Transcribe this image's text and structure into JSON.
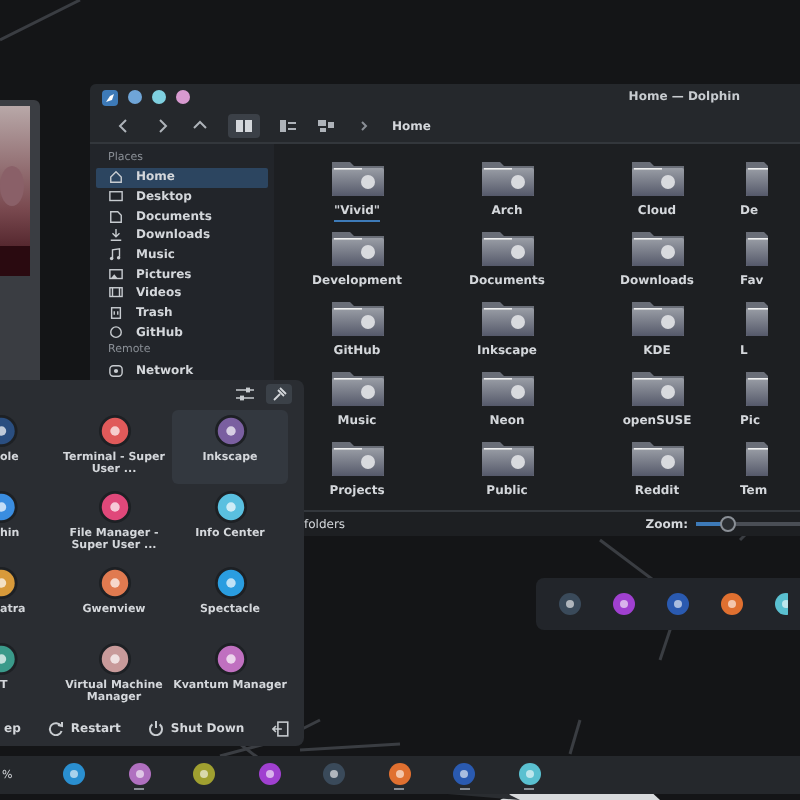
{
  "dolphin": {
    "title": "Home — Dolphin",
    "breadcrumb": "Home",
    "places_header": "Places",
    "places": [
      {
        "label": "Home",
        "selected": true
      },
      {
        "label": "Desktop",
        "selected": false
      },
      {
        "label": "Documents",
        "selected": false
      },
      {
        "label": "Downloads",
        "selected": false
      },
      {
        "label": "Music",
        "selected": false
      },
      {
        "label": "Pictures",
        "selected": false
      },
      {
        "label": "Videos",
        "selected": false
      },
      {
        "label": "Trash",
        "selected": false
      },
      {
        "label": "GitHub",
        "selected": false
      }
    ],
    "remote_header": "Remote",
    "remote": [
      {
        "label": "Network",
        "selected": false
      }
    ],
    "folders": [
      {
        "label": "\"Vivid\"",
        "selected": true
      },
      {
        "label": "Arch",
        "selected": false
      },
      {
        "label": "Cloud",
        "selected": false
      },
      {
        "label": "De",
        "selected": false
      },
      {
        "label": "Development",
        "selected": false
      },
      {
        "label": "Documents",
        "selected": false
      },
      {
        "label": "Downloads",
        "selected": false
      },
      {
        "label": "Fav",
        "selected": false
      },
      {
        "label": "GitHub",
        "selected": false
      },
      {
        "label": "Inkscape",
        "selected": false
      },
      {
        "label": "KDE",
        "selected": false
      },
      {
        "label": "L",
        "selected": false
      },
      {
        "label": "Music",
        "selected": false
      },
      {
        "label": "Neon",
        "selected": false
      },
      {
        "label": "openSUSE",
        "selected": false
      },
      {
        "label": "Pic",
        "selected": false
      },
      {
        "label": "Projects",
        "selected": false
      },
      {
        "label": "Public",
        "selected": false
      },
      {
        "label": "Reddit",
        "selected": false
      },
      {
        "label": "Tem",
        "selected": false
      }
    ],
    "status": "folders",
    "zoom_label": "Zoom:",
    "zoom": {
      "level": 0.3
    }
  },
  "launcher": {
    "apps": [
      {
        "label": "ole",
        "color": "#2a4e80",
        "selected": false
      },
      {
        "label": "Terminal - Super User ...",
        "color": "#e05a5a",
        "selected": false
      },
      {
        "label": "Inkscape",
        "color": "#7a5fa0",
        "selected": true
      },
      {
        "label": "hin",
        "color": "#3a8de0",
        "selected": false
      },
      {
        "label": "File Manager - Super User ...",
        "color": "#e0487a",
        "selected": false
      },
      {
        "label": "Info Center",
        "color": "#5ac0e0",
        "selected": false
      },
      {
        "label": "atra",
        "color": "#d89a3a",
        "selected": false
      },
      {
        "label": "Gwenview",
        "color": "#e07a50",
        "selected": false
      },
      {
        "label": "Spectacle",
        "color": "#2a9de0",
        "selected": false
      },
      {
        "label": "T",
        "color": "#3a9a8a",
        "selected": false
      },
      {
        "label": "Virtual Machine Manager",
        "color": "#c89a9a",
        "selected": false
      },
      {
        "label": "Kvantum Manager",
        "color": "#c070c0",
        "selected": false
      }
    ],
    "power": [
      {
        "label": "ep"
      },
      {
        "label": "Restart"
      },
      {
        "label": "Shut Down"
      }
    ]
  },
  "dock": {
    "apps": [
      {
        "color": "#3a4a5a"
      },
      {
        "color": "#a040d0"
      },
      {
        "color": "#2a5ab0"
      },
      {
        "color": "#e07030"
      },
      {
        "color": "#5ac0d0"
      }
    ]
  },
  "taskbar": {
    "battery": "%",
    "apps": [
      {
        "color": "#2a8fd0",
        "running": false
      },
      {
        "color": "#b070c0",
        "running": true
      },
      {
        "color": "#a0a030",
        "running": false
      },
      {
        "color": "#a040d0",
        "running": false
      },
      {
        "color": "#3a4a5a",
        "running": false
      },
      {
        "color": "#e07030",
        "running": true
      },
      {
        "color": "#2a5ab0",
        "running": true
      },
      {
        "color": "#5ac0d0",
        "running": true
      }
    ]
  }
}
